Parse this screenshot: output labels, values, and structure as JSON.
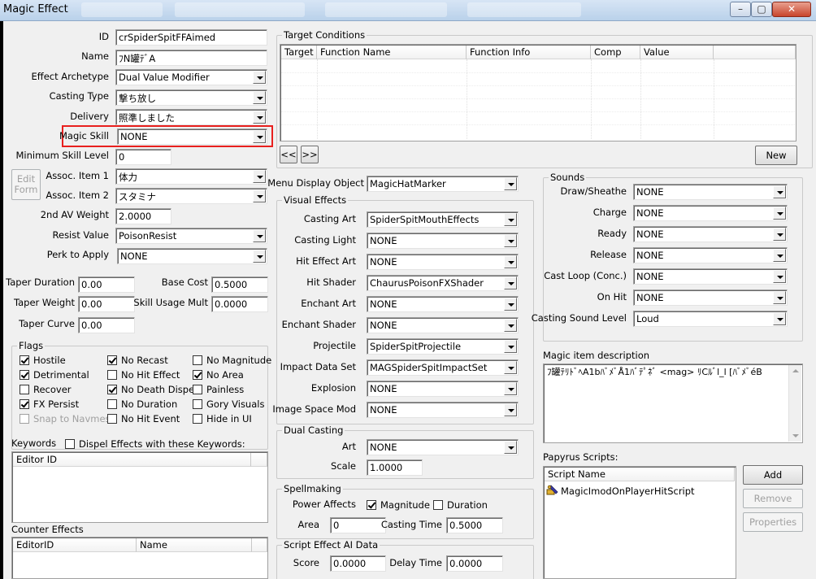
{
  "window": {
    "title": "Magic Effect",
    "controls": {
      "minimize": "–",
      "maximize": "▢",
      "close": "✕"
    }
  },
  "left": {
    "id_label": "ID",
    "id_value": "crSpiderSpitFFAimed",
    "name_label": "Name",
    "name_value": "ﾌN罐ﾃﾞA",
    "archetype_label": "Effect Archetype",
    "archetype_value": "Dual Value Modifier",
    "casting_type_label": "Casting Type",
    "casting_type_value": "撃ち放し",
    "delivery_label": "Delivery",
    "delivery_value": "照準しました",
    "magic_skill_label": "Magic Skill",
    "magic_skill_value": "NONE",
    "min_skill_label": "Minimum Skill Level",
    "min_skill_value": "0",
    "edit_form_button": "Edit Form",
    "assoc1_label": "Assoc. Item 1",
    "assoc1_value": "体力",
    "assoc2_label": "Assoc. Item 2",
    "assoc2_value": "スタミナ",
    "av_weight_label": "2nd AV Weight",
    "av_weight_value": "2.0000",
    "resist_label": "Resist Value",
    "resist_value": "PoisonResist",
    "perk_label": "Perk to Apply",
    "perk_value": "NONE",
    "taper_duration_label": "Taper Duration",
    "taper_duration_value": "0.00",
    "base_cost_label": "Base Cost",
    "base_cost_value": "0.5000",
    "taper_weight_label": "Taper Weight",
    "taper_weight_value": "0.00",
    "skill_usage_label": "Skill Usage Mult",
    "skill_usage_value": "0.0000",
    "taper_curve_label": "Taper Curve",
    "taper_curve_value": "0.00"
  },
  "flags": {
    "title": "Flags",
    "items": [
      {
        "label": "Hostile",
        "checked": true,
        "disabled": false
      },
      {
        "label": "No Recast",
        "checked": true,
        "disabled": false
      },
      {
        "label": "No Magnitude",
        "checked": false,
        "disabled": false
      },
      {
        "label": "Detrimental",
        "checked": true,
        "disabled": false
      },
      {
        "label": "No Hit Effect",
        "checked": false,
        "disabled": false
      },
      {
        "label": "No Area",
        "checked": true,
        "disabled": false
      },
      {
        "label": "Recover",
        "checked": false,
        "disabled": false
      },
      {
        "label": "No Death Dispel",
        "checked": true,
        "disabled": false
      },
      {
        "label": "Painless",
        "checked": false,
        "disabled": false
      },
      {
        "label": "FX Persist",
        "checked": true,
        "disabled": false
      },
      {
        "label": "No Duration",
        "checked": false,
        "disabled": false
      },
      {
        "label": "Gory Visuals",
        "checked": false,
        "disabled": false
      },
      {
        "label": "Snap to Navmesh",
        "checked": false,
        "disabled": true
      },
      {
        "label": "No Hit Event",
        "checked": false,
        "disabled": false
      },
      {
        "label": "Hide in UI",
        "checked": false,
        "disabled": false
      }
    ]
  },
  "keywords": {
    "label": "Keywords",
    "dispel_label": "Dispel Effects with these Keywords:",
    "column": "Editor ID"
  },
  "counter_effects": {
    "label": "Counter Effects",
    "columns": [
      "EditorID",
      "Name"
    ]
  },
  "target_conditions": {
    "title": "Target Conditions",
    "columns": [
      "Target",
      "Function Name",
      "Function Info",
      "Comp",
      "Value"
    ],
    "prev_button": "<<",
    "next_button": ">>",
    "new_button": "New"
  },
  "menu_display": {
    "label": "Menu Display Object",
    "value": "MagicHatMarker"
  },
  "visual_effects": {
    "title": "Visual Effects",
    "rows": [
      {
        "label": "Casting Art",
        "value": "SpiderSpitMouthEffects"
      },
      {
        "label": "Casting Light",
        "value": "NONE"
      },
      {
        "label": "Hit Effect Art",
        "value": "NONE"
      },
      {
        "label": "Hit Shader",
        "value": "ChaurusPoisonFXShader"
      },
      {
        "label": "Enchant Art",
        "value": "NONE"
      },
      {
        "label": "Enchant Shader",
        "value": "NONE"
      },
      {
        "label": "Projectile",
        "value": "SpiderSpitProjectile"
      },
      {
        "label": "Impact Data Set",
        "value": "MAGSpiderSpitImpactSet"
      },
      {
        "label": "Explosion",
        "value": "NONE"
      },
      {
        "label": "Image Space Mod",
        "value": "NONE"
      }
    ]
  },
  "dual_casting": {
    "title": "Dual Casting",
    "art_label": "Art",
    "art_value": "NONE",
    "scale_label": "Scale",
    "scale_value": "1.0000"
  },
  "spellmaking": {
    "title": "Spellmaking",
    "power_affects_label": "Power Affects",
    "magnitude_label": "Magnitude",
    "magnitude_checked": true,
    "duration_label": "Duration",
    "duration_checked": false,
    "area_label": "Area",
    "area_value": "0",
    "casting_time_label": "Casting Time",
    "casting_time_value": "0.5000"
  },
  "script_ai": {
    "title": "Script Effect AI Data",
    "score_label": "Score",
    "score_value": "0.0000",
    "delay_label": "Delay Time",
    "delay_value": "0.0000"
  },
  "sounds": {
    "title": "Sounds",
    "rows": [
      {
        "label": "Draw/Sheathe",
        "value": "NONE"
      },
      {
        "label": "Charge",
        "value": "NONE"
      },
      {
        "label": "Ready",
        "value": "NONE"
      },
      {
        "label": "Release",
        "value": "NONE"
      },
      {
        "label": "Cast Loop (Conc.)",
        "value": "NONE"
      },
      {
        "label": "On Hit",
        "value": "NONE"
      },
      {
        "label": "Casting Sound Level",
        "value": "Loud"
      }
    ]
  },
  "description": {
    "label": "Magic item description",
    "text": "ﾌ罐ﾃﾘﾄﾞﾍA1bﾊﾞﾒﾞÅ1ﾊﾞﾃﾟﾈﾞ <mag> ﾘCﾙﾞl_l [ﾊﾞﾒﾞéB"
  },
  "papyrus": {
    "label": "Papyrus Scripts:",
    "column": "Script Name",
    "scripts": [
      "MagicImodOnPlayerHitScript"
    ],
    "add_button": "Add",
    "remove_button": "Remove",
    "properties_button": "Properties"
  }
}
